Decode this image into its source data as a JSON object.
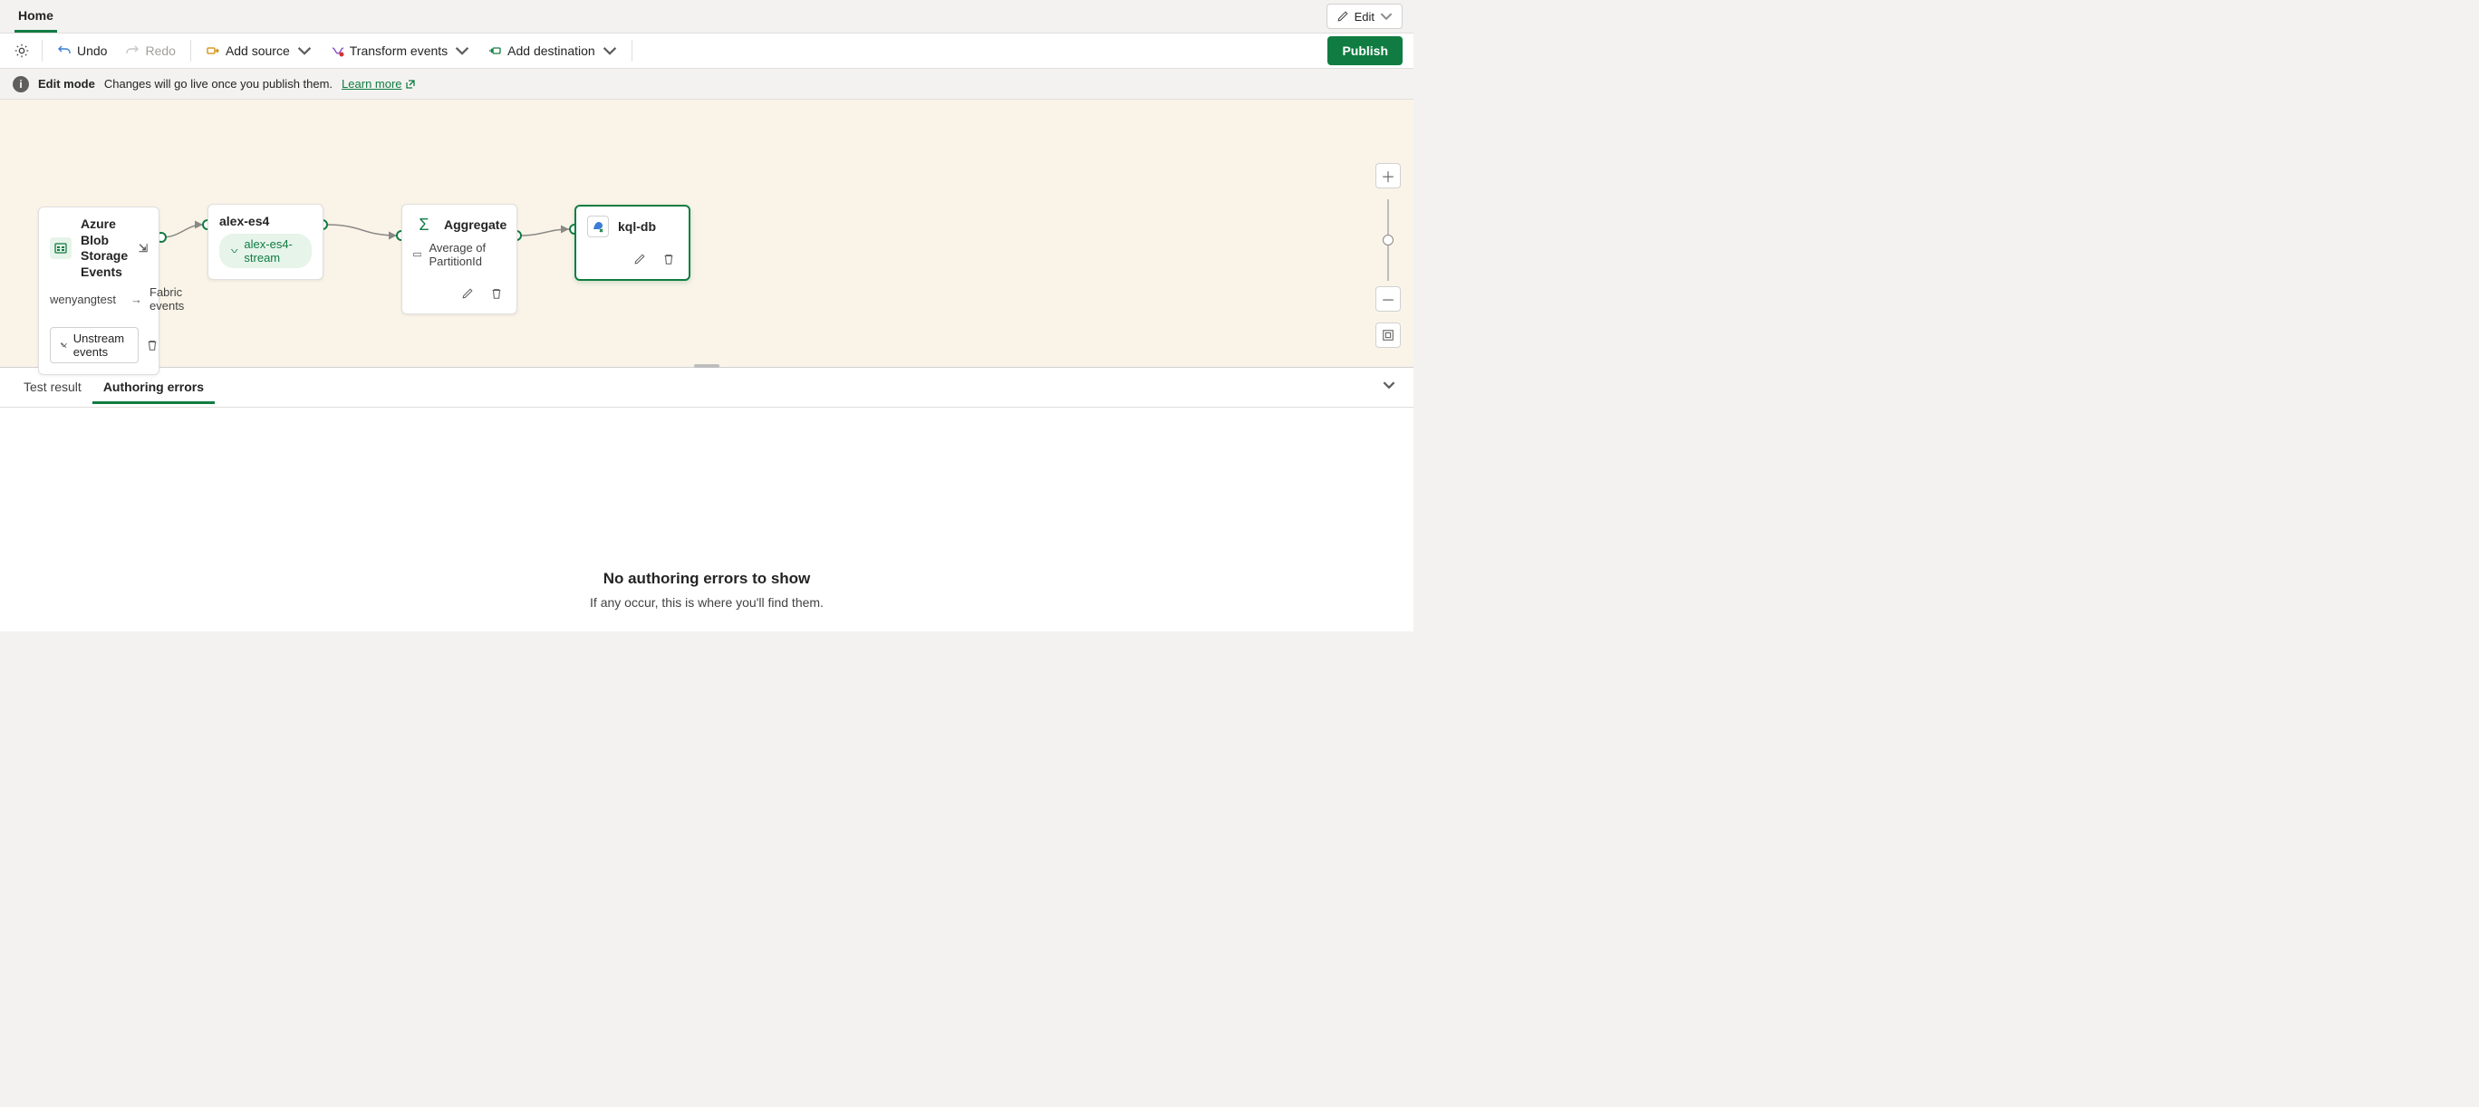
{
  "topTab": "Home",
  "editBtn": "Edit",
  "toolbar": {
    "undo": "Undo",
    "redo": "Redo",
    "addSource": "Add source",
    "transform": "Transform events",
    "addDest": "Add destination",
    "publish": "Publish"
  },
  "infobar": {
    "mode": "Edit mode",
    "msg": "Changes will go live once you publish them.",
    "learn": "Learn more"
  },
  "nodes": {
    "source": {
      "title": "Azure Blob Storage Events",
      "owner": "wenyangtest",
      "connector": "Fabric events",
      "action": "Unstream events"
    },
    "stream": {
      "title": "alex-es4",
      "pill": "alex-es4-stream"
    },
    "agg": {
      "title": "Aggregate",
      "desc": "Average of PartitionId"
    },
    "dest": {
      "title": "kql-db"
    }
  },
  "bottom": {
    "tab1": "Test result",
    "tab2": "Authoring errors",
    "emptyTitle": "No authoring errors to show",
    "emptySub": "If any occur, this is where you'll find them."
  }
}
